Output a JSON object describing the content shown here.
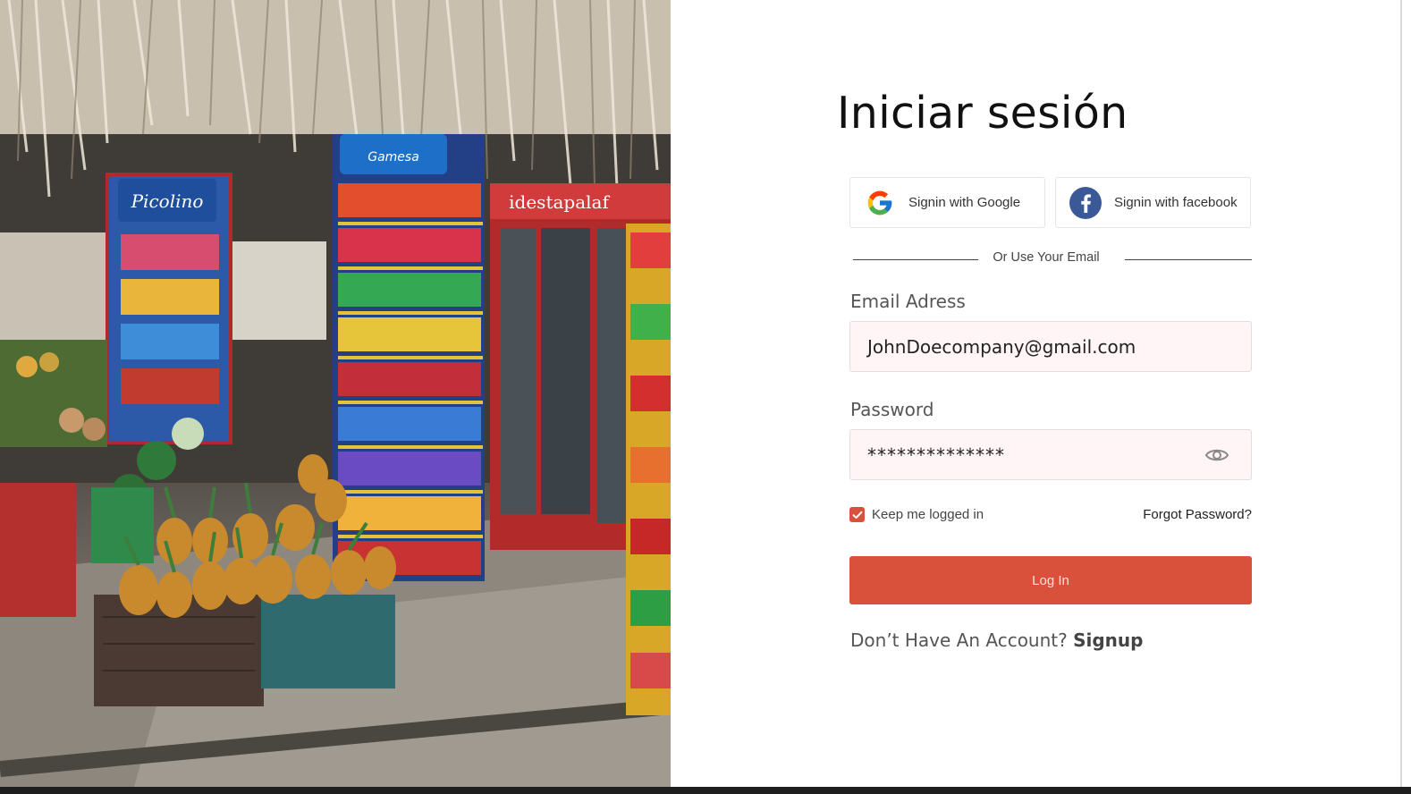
{
  "page": {
    "title": "Iniciar sesión"
  },
  "social": {
    "google_label": "Signin with Google",
    "facebook_label": "Signin with facebook",
    "divider_text": "Or Use Your Email"
  },
  "form": {
    "email_label": "Email Adress",
    "email_value": "JohnDoecompany@gmail.com",
    "password_label": "Password",
    "password_value": "**************",
    "remember_label": "Keep me logged in",
    "remember_checked": true,
    "forgot_label": "Forgot Password?",
    "login_label": "Log In",
    "no_account_text": "Don’t Have An Account?",
    "signup_label": "Signup"
  },
  "photo": {
    "sign_text": "Picolino",
    "cooler_text": "idestapalaf",
    "box_text": "Gamesa"
  },
  "colors": {
    "accent": "#d9503b",
    "field_bg": "#fff4f6",
    "facebook_blue": "#3b5998"
  },
  "icons": {
    "google": "google-icon",
    "facebook": "facebook-icon",
    "eye": "eye-icon",
    "check": "check-icon"
  }
}
